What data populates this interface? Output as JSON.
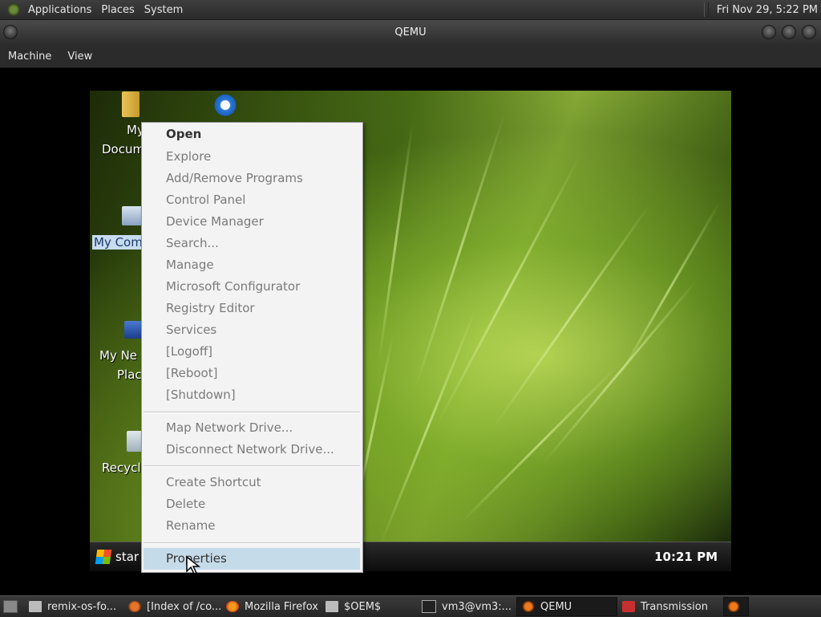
{
  "top_panel": {
    "menus": [
      "Applications",
      "Places",
      "System"
    ],
    "clock": "Fri Nov 29,  5:22 PM"
  },
  "window": {
    "title": "QEMU",
    "menus": [
      "Machine",
      "View"
    ]
  },
  "guest": {
    "desktop_icons": {
      "my_documents": [
        "My",
        "Docum"
      ],
      "my_computer": "My Com",
      "my_network": [
        "My Ne",
        "Plac"
      ],
      "recycle": "Recycl"
    },
    "start_label": "star",
    "clock": "10:21 PM",
    "context_menu": {
      "default_item": "Open",
      "group1": [
        "Explore",
        "Add/Remove Programs",
        "Control Panel",
        "Device Manager",
        "Search...",
        "Manage",
        "Microsoft Configurator",
        "Registry Editor",
        "Services",
        "[Logoff]",
        "[Reboot]",
        "[Shutdown]"
      ],
      "group2": [
        "Map Network Drive...",
        "Disconnect Network Drive..."
      ],
      "group3": [
        "Create Shortcut",
        "Delete",
        "Rename"
      ],
      "highlighted": "Properties"
    }
  },
  "bottom_panel": {
    "tasks": [
      "remix-os-fo...",
      "[Index of /co...",
      "Mozilla Firefox",
      "$OEM$",
      "vm3@vm3:...",
      "QEMU",
      "Transmission"
    ]
  },
  "colors": {
    "menu_highlight": "#c5dbe9",
    "selection": "#c8dcef"
  }
}
